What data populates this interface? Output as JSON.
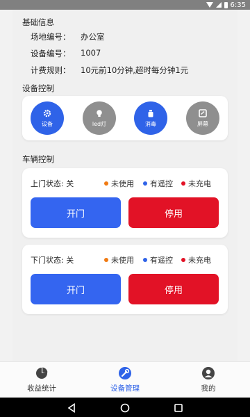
{
  "status_bar": {
    "time": "6:35"
  },
  "basic_info": {
    "title": "基础信息",
    "rows": [
      {
        "label": "场地编号：",
        "value": "办公室"
      },
      {
        "label": "设备编号：",
        "value": "1007"
      },
      {
        "label": "计费规则：",
        "value": "10元前10分钟,超时每分钟1元"
      }
    ]
  },
  "device_control": {
    "title": "设备控制",
    "buttons": [
      {
        "label": "设备",
        "icon": "gear-icon",
        "color": "#2f63e8"
      },
      {
        "label": "led灯",
        "icon": "bulb-icon",
        "color": "#8f8f8f"
      },
      {
        "label": "消毒",
        "icon": "spray-icon",
        "color": "#2f63e8"
      },
      {
        "label": "屏幕",
        "icon": "screen-icon",
        "color": "#8f8f8f"
      }
    ]
  },
  "vehicle_control": {
    "title": "车辆控制",
    "legend": [
      {
        "label": "未使用",
        "color": "#f07a12"
      },
      {
        "label": "有遥控",
        "color": "#2f63e8"
      },
      {
        "label": "未充电",
        "color": "#e21226"
      }
    ],
    "doors": [
      {
        "state_label": "上门状态:",
        "state_value": "关",
        "open_label": "开门",
        "stop_label": "停用"
      },
      {
        "state_label": "下门状态:",
        "state_value": "关",
        "open_label": "开门",
        "stop_label": "停用"
      }
    ]
  },
  "tabbar": {
    "items": [
      {
        "label": "收益统计",
        "icon": "pie-chart-icon"
      },
      {
        "label": "设备管理",
        "icon": "wrench-icon",
        "active": true
      },
      {
        "label": "我的",
        "icon": "user-icon"
      }
    ]
  }
}
